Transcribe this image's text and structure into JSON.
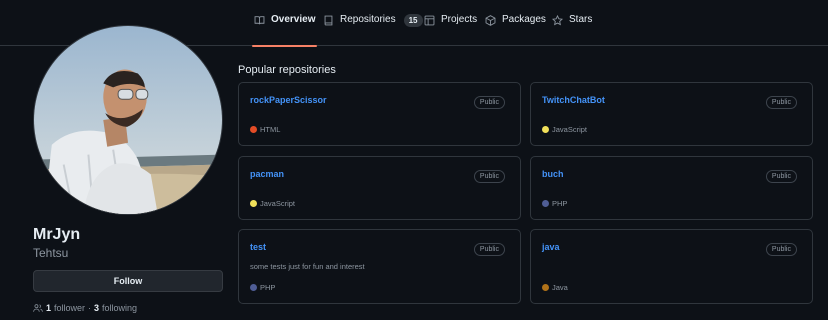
{
  "tabs": [
    {
      "label": "Overview",
      "icon": "book-icon",
      "active": true
    },
    {
      "label": "Repositories",
      "icon": "repo-icon",
      "count": "15"
    },
    {
      "label": "Projects",
      "icon": "table-icon"
    },
    {
      "label": "Packages",
      "icon": "package-icon"
    },
    {
      "label": "Stars",
      "icon": "star-icon"
    }
  ],
  "profile": {
    "name": "MrJyn",
    "login": "Tehtsu",
    "follow_label": "Follow",
    "followers_count": "1",
    "followers_label": "follower",
    "separator": "·",
    "following_count": "3",
    "following_label": "following"
  },
  "popular": {
    "title": "Popular repositories",
    "repos": [
      {
        "name": "rockPaperScissor",
        "visibility": "Public",
        "description": "",
        "language": "HTML",
        "color": "#e34c26"
      },
      {
        "name": "TwitchChatBot",
        "visibility": "Public",
        "description": "",
        "language": "JavaScript",
        "color": "#f1e05a"
      },
      {
        "name": "pacman",
        "visibility": "Public",
        "description": "",
        "language": "JavaScript",
        "color": "#f1e05a"
      },
      {
        "name": "buch",
        "visibility": "Public",
        "description": "",
        "language": "PHP",
        "color": "#4f5d95"
      },
      {
        "name": "test",
        "visibility": "Public",
        "description": "some tests just for fun and interest",
        "language": "PHP",
        "color": "#4f5d95"
      },
      {
        "name": "java",
        "visibility": "Public",
        "description": "",
        "language": "Java",
        "color": "#b07219"
      }
    ]
  },
  "colors": {
    "accent_underline": "#f78166",
    "link": "#4493f8"
  }
}
